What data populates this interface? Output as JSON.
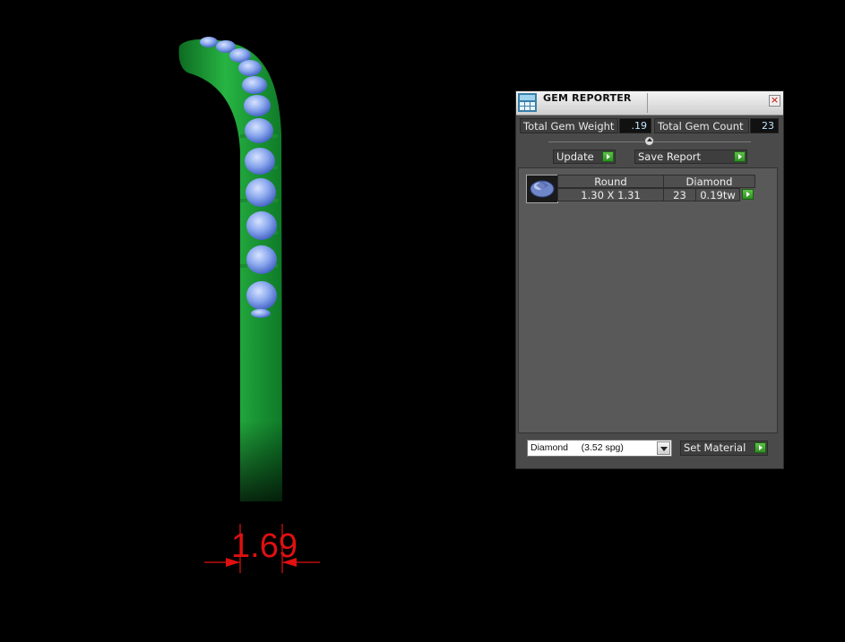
{
  "viewport": {
    "dimension_value": "1.69",
    "dimension_color": "#e01010",
    "band_color": "#1fa33a",
    "gem_color": "#8aa8f0"
  },
  "panel": {
    "title": "GEM REPORTER",
    "title_icon": "gem-reporter-icon",
    "close_symbol": "×",
    "total_weight_label": "Total Gem Weight",
    "total_weight_value": ".19",
    "total_count_label": "Total Gem Count",
    "total_count_value": "23",
    "update_label": "Update",
    "save_report_label": "Save Report",
    "table": {
      "header": [
        "Round",
        "Diamond"
      ],
      "row": {
        "size": "1.30 X 1.31",
        "count": "23",
        "weight": "0.19tw"
      }
    },
    "material_select": {
      "value": "Diamond     (3.52 spg)"
    },
    "set_material_label": "Set Material"
  }
}
